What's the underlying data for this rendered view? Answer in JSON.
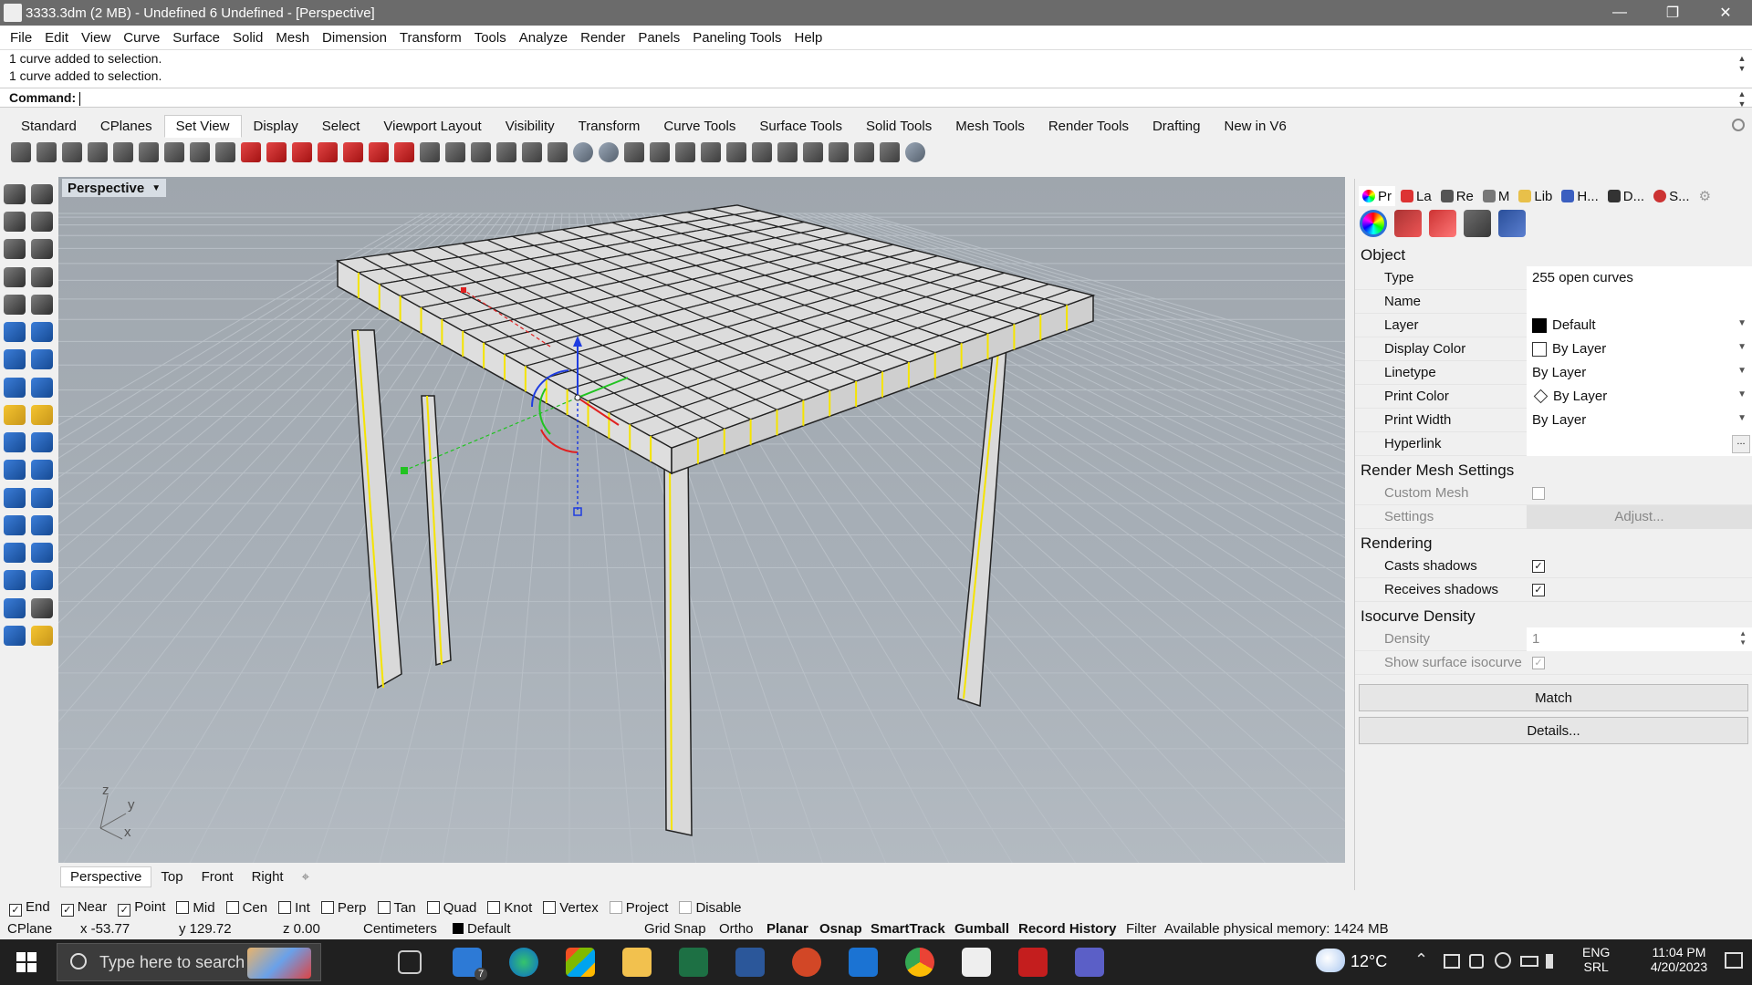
{
  "window": {
    "title": "3333.3dm (2 MB) - Undefined 6 Undefined - [Perspective]",
    "minimize": "—",
    "maximize": "❐",
    "close": "✕"
  },
  "menu": [
    "File",
    "Edit",
    "View",
    "Curve",
    "Surface",
    "Solid",
    "Mesh",
    "Dimension",
    "Transform",
    "Tools",
    "Analyze",
    "Render",
    "Panels",
    "Paneling Tools",
    "Help"
  ],
  "command_history": [
    "1 curve added to selection.",
    "1 curve added to selection."
  ],
  "command_prompt": "Command:",
  "toolbar_tabs": [
    "Standard",
    "CPlanes",
    "Set View",
    "Display",
    "Select",
    "Viewport Layout",
    "Visibility",
    "Transform",
    "Curve Tools",
    "Surface Tools",
    "Solid Tools",
    "Mesh Tools",
    "Render Tools",
    "Drafting",
    "New in V6"
  ],
  "active_toolbar_tab": "Set View",
  "viewport": {
    "label": "Perspective",
    "axis_z": "z",
    "axis_y": "y",
    "axis_x": "x"
  },
  "view_tabs": [
    "Perspective",
    "Top",
    "Front",
    "Right"
  ],
  "view_tabs_add": "⌖",
  "osnap": [
    {
      "label": "End",
      "checked": true
    },
    {
      "label": "Near",
      "checked": true
    },
    {
      "label": "Point",
      "checked": true
    },
    {
      "label": "Mid",
      "checked": false
    },
    {
      "label": "Cen",
      "checked": false
    },
    {
      "label": "Int",
      "checked": false
    },
    {
      "label": "Perp",
      "checked": false
    },
    {
      "label": "Tan",
      "checked": false
    },
    {
      "label": "Quad",
      "checked": false
    },
    {
      "label": "Knot",
      "checked": false
    },
    {
      "label": "Vertex",
      "checked": false
    },
    {
      "label": "Project",
      "checked": false
    },
    {
      "label": "Disable",
      "checked": false
    }
  ],
  "status": {
    "cplane": "CPlane",
    "x": "x -53.77",
    "y": "y 129.72",
    "z": "z 0.00",
    "units": "Centimeters",
    "layer": "Default",
    "grid_snap": "Grid Snap",
    "ortho": "Ortho",
    "planar": "Planar",
    "osnap": "Osnap",
    "smarttrack": "SmartTrack",
    "gumball": "Gumball",
    "record_history": "Record History",
    "filter": "Filter",
    "memory": "Available physical memory: 1424 MB"
  },
  "panel_tabs": [
    "Pr",
    "La",
    "Re",
    "M",
    "Lib",
    "H...",
    "D...",
    "S..."
  ],
  "properties": {
    "object_heading": "Object",
    "type_label": "Type",
    "type_value": "255 open curves",
    "name_label": "Name",
    "name_value": "",
    "layer_label": "Layer",
    "layer_value": "Default",
    "display_color_label": "Display Color",
    "display_color_value": "By Layer",
    "linetype_label": "Linetype",
    "linetype_value": "By Layer",
    "print_color_label": "Print Color",
    "print_color_value": "By Layer",
    "print_width_label": "Print Width",
    "print_width_value": "By Layer",
    "hyperlink_label": "Hyperlink",
    "hyperlink_button": "...",
    "render_mesh_heading": "Render Mesh Settings",
    "custom_mesh_label": "Custom Mesh",
    "settings_label": "Settings",
    "adjust_button": "Adjust...",
    "rendering_heading": "Rendering",
    "casts_shadows_label": "Casts shadows",
    "receives_shadows_label": "Receives shadows",
    "isocurve_heading": "Isocurve Density",
    "density_label": "Density",
    "density_value": "1",
    "show_isocurve_label": "Show surface isocurve",
    "match_button": "Match",
    "details_button": "Details..."
  },
  "taskbar": {
    "search_placeholder": "Type here to search",
    "weather": "12°C",
    "lang1": "ENG",
    "lang2": "SRL",
    "time": "11:04 PM",
    "date": "4/20/2023",
    "mail_badge": "7"
  },
  "colors": {
    "viewport_bg": "#a7afb7",
    "selection_yellow": "#f5e400",
    "gumball_red": "#e02020",
    "gumball_green": "#21c321",
    "gumball_blue": "#1f3de0"
  }
}
